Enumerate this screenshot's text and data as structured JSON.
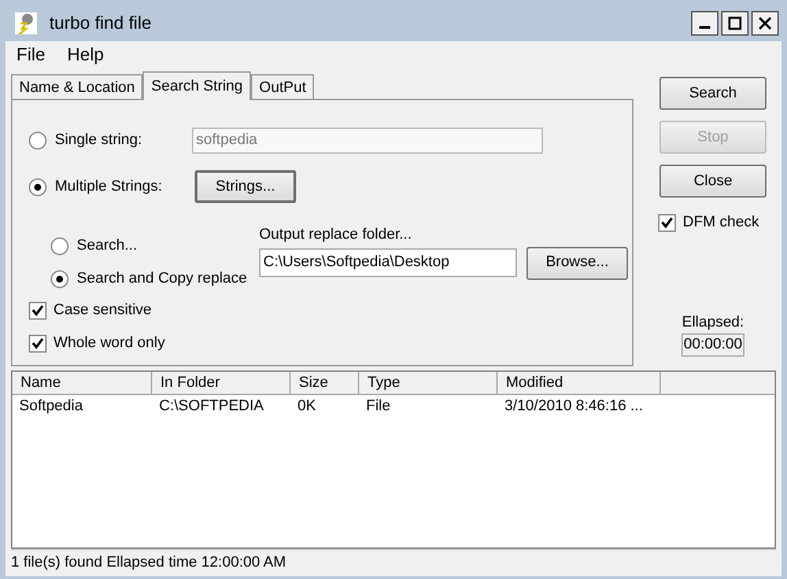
{
  "window": {
    "title": "turbo find file"
  },
  "menu": [
    "File",
    "Help"
  ],
  "tabs": [
    {
      "label": "Name & Location",
      "selected": false
    },
    {
      "label": "Search String",
      "selected": true
    },
    {
      "label": "OutPut",
      "selected": false
    }
  ],
  "search_mode": [
    {
      "label": "Single string:",
      "selected": false,
      "value": "softpedia"
    },
    {
      "label": "Multiple Strings:",
      "selected": true,
      "button": "Strings..."
    }
  ],
  "action": [
    {
      "label": "Search...",
      "selected": false
    },
    {
      "label": "Search and Copy replace",
      "selected": true
    }
  ],
  "output_folder": {
    "label": "Output replace folder...",
    "value": "C:\\Users\\Softpedia\\Desktop",
    "button": "Browse..."
  },
  "options": [
    {
      "label": "Case sensitive",
      "checked": true
    },
    {
      "label": "Whole word only",
      "checked": true
    }
  ],
  "buttons": [
    {
      "label": "Search",
      "disabled": false
    },
    {
      "label": "Stop",
      "disabled": true
    },
    {
      "label": "Close",
      "disabled": false
    }
  ],
  "dfm_check": {
    "label": "DFM check",
    "checked": true
  },
  "elapsed": {
    "label": "Ellapsed:",
    "value": "00:00:00"
  },
  "table": {
    "columns": [
      "Name",
      "In Folder",
      "Size",
      "Type",
      "Modified"
    ],
    "rows": [
      [
        "Softpedia",
        "C:\\SOFTPEDIA",
        "0K",
        "File",
        "3/10/2010 8:46:16 ..."
      ]
    ]
  },
  "status_bar": "1 file(s) found Ellapsed time 12:00:00 AM"
}
